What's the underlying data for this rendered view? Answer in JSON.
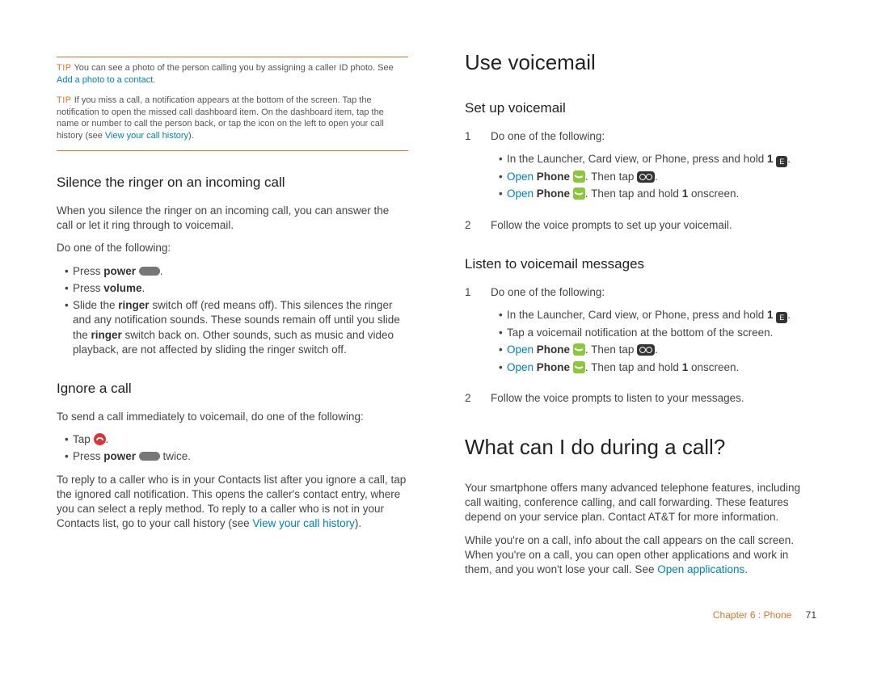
{
  "left": {
    "tip1_label": "TIP",
    "tip1_text": "You can see a photo of the person calling you by assigning a caller ID photo. See ",
    "tip1_link": "Add a photo to a contact",
    "tip1_after": ".",
    "tip2_label": "TIP",
    "tip2_text": "If you miss a call, a notification appears at the bottom of the screen. Tap the notification to open the missed call dashboard item. On the dashboard item, tap the name or number to call the person back, or tap the icon on the left to open your call history (see ",
    "tip2_link": "View your call history",
    "tip2_after": ").",
    "h_silence": "Silence the ringer on an incoming call",
    "p_silence": "When you silence the ringer on an incoming call, you can answer the call or let it ring through to voicemail.",
    "p_doone": "Do one of the following:",
    "b_press": "Press ",
    "b_power": "power",
    "b_powersuffix": " ",
    "b_powerend": ".",
    "b_volume_pre": "Press ",
    "b_volume": "volume",
    "b_volume_post": ".",
    "b_slide_1": "Slide the ",
    "b_slide_ringer": "ringer",
    "b_slide_2": " switch off (red means off). This silences the ringer and any notification sounds. These sounds remain off until you slide the ",
    "b_slide_3": " switch back on. Other sounds, such as music and video playback, are not affected by sliding the ringer switch off.",
    "h_ignore": "Ignore a call",
    "p_ignore": "To send a call immediately to voicemail, do one of the following:",
    "b_tap": "Tap ",
    "b_tap_end": ".",
    "b_presspower2_pre": "Press ",
    "b_presspower2_bold": "power",
    "b_presspower2_post": " twice.",
    "p_reply_1": "To reply to a caller who is in your Contacts list after you ignore a call, tap the ignored call notification. This opens the caller's contact entry, where you can select a reply method. To reply to a caller who is not in your Contacts list, go to your call history (see ",
    "p_reply_link": "View your call history",
    "p_reply_2": ")."
  },
  "right": {
    "h_usevm": "Use voicemail",
    "h_setup": "Set up voicemail",
    "n1": "1",
    "n1_text": "Do one of the following:",
    "b1a_pre": "In the Launcher, Card view, or Phone, press and hold ",
    "b1a_1": "1",
    "b1a_sp": " ",
    "b1a_post": ".",
    "bOpen": "Open",
    "bPhone": "Phone",
    "bThenTap": ". Then tap ",
    "bDot": ".",
    "bThenTapHold_pre": ". Then tap and hold ",
    "bOne": "1",
    "bThenTapHold_post": " onscreen.",
    "n2": "2",
    "n2_text": "Follow the voice prompts to set up your voicemail.",
    "h_listen": "Listen to voicemail messages",
    "l_n1": "1",
    "l_n1_text": "Do one of the following:",
    "l_b2": "Tap a voicemail notification at the bottom of the screen.",
    "l_n2": "2",
    "l_n2_text": "Follow the voice prompts to listen to your messages.",
    "h_during": "What can I do during a call?",
    "p_during1": "Your smartphone offers many advanced telephone features, including call waiting, conference calling, and call forwarding. These features depend on your service plan. Contact AT&T for more information.",
    "p_during2_a": "While you're on a call, info about the call appears on the call screen. When you're on a call, you can open other applications and work in them, and you won't lose your call. See ",
    "p_during2_link": "Open applications",
    "p_during2_b": ".",
    "footer_chapter": "Chapter 6 : Phone",
    "footer_page": "71"
  }
}
